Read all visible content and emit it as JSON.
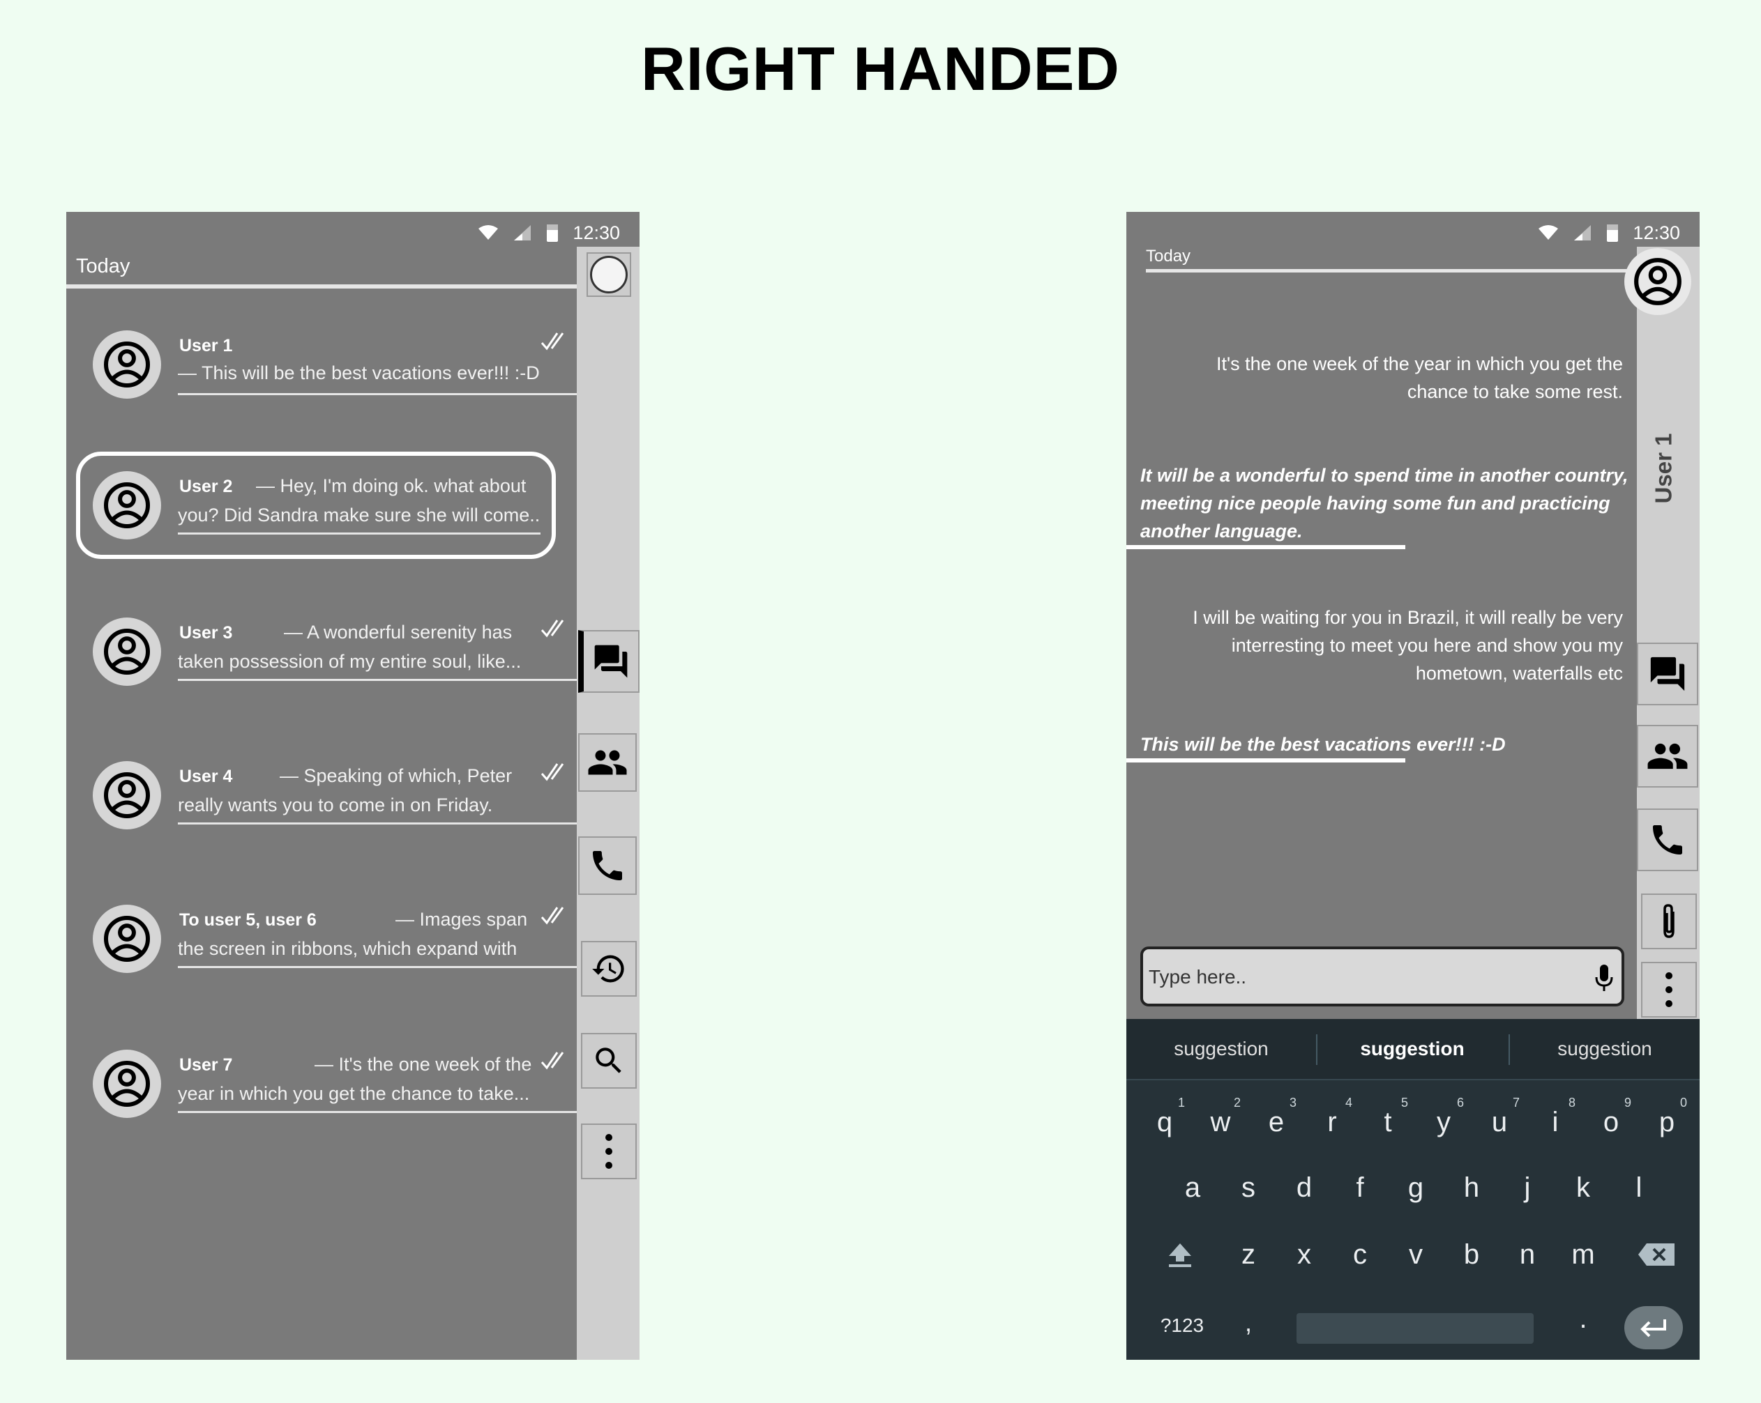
{
  "title": "RIGHT HANDED",
  "status_bar": {
    "time": "12:30"
  },
  "left_phone": {
    "section_label": "Today",
    "conversations": [
      {
        "name": "User 1",
        "line1": "— This  will be the best vacations ever!!! :-D",
        "line2": "",
        "checkmarks": true
      },
      {
        "name": "User 2",
        "line1": "— Hey, I'm doing ok. what about",
        "line2": "you? Did Sandra make sure she will come..",
        "checkmarks": false,
        "highlighted": true
      },
      {
        "name": "User 3",
        "line1": "— A wonderful serenity has",
        "line2": "taken possession of my entire soul, like...",
        "checkmarks": true
      },
      {
        "name": "User 4",
        "line1": "— Speaking of which, Peter",
        "line2": "really wants you to come in on Friday.",
        "checkmarks": true
      },
      {
        "name": "To user 5, user 6",
        "line1": "— Images span",
        "line2": "the screen in ribbons, which expand with",
        "checkmarks": true
      },
      {
        "name": "User 7",
        "line1": "— It's the one week of the",
        "line2": "year in which you get the chance to take...",
        "checkmarks": true
      }
    ],
    "rail_icons": [
      "circle-icon",
      "forum-icon",
      "people-icon",
      "phone-icon",
      "history-icon",
      "search-icon",
      "more-vert-icon"
    ],
    "active_rail": "forum-icon"
  },
  "right_phone": {
    "section_label": "Today",
    "contact_name": "User 1",
    "messages": [
      {
        "direction": "in",
        "text": "It's the one week of the year in which you get the chance to take some rest."
      },
      {
        "direction": "out",
        "text": "It will be a wonderful to spend time in another country, meeting nice people having some fun and practicing another language."
      },
      {
        "direction": "in",
        "text": "I will be waiting for you in Brazil, it will really be very interresting to meet you here and show you my hometown, waterfalls etc"
      },
      {
        "direction": "out",
        "text": "This  will be the best vacations ever!!! :-D"
      }
    ],
    "rail_icons": [
      "forum-icon",
      "people-icon",
      "phone-icon",
      "attach-icon",
      "more-vert-icon"
    ],
    "input_placeholder": "Type here..",
    "keyboard": {
      "suggestions": [
        "suggestion",
        "suggestion",
        "suggestion"
      ],
      "row1": [
        "q",
        "w",
        "e",
        "r",
        "t",
        "y",
        "u",
        "i",
        "o",
        "p"
      ],
      "row1_numbers": [
        "1",
        "2",
        "3",
        "4",
        "5",
        "6",
        "7",
        "8",
        "9",
        "0"
      ],
      "row2": [
        "a",
        "s",
        "d",
        "f",
        "g",
        "h",
        "j",
        "k",
        "l"
      ],
      "row3": [
        "z",
        "x",
        "c",
        "v",
        "b",
        "n",
        "m"
      ],
      "symbols_key": "?123",
      "comma_key": ",",
      "period_key": "."
    }
  },
  "colors": {
    "background": "#effdf2",
    "phone": "#7a7a7a",
    "rail": "#cfcfcf",
    "keyboard": "#263238"
  }
}
